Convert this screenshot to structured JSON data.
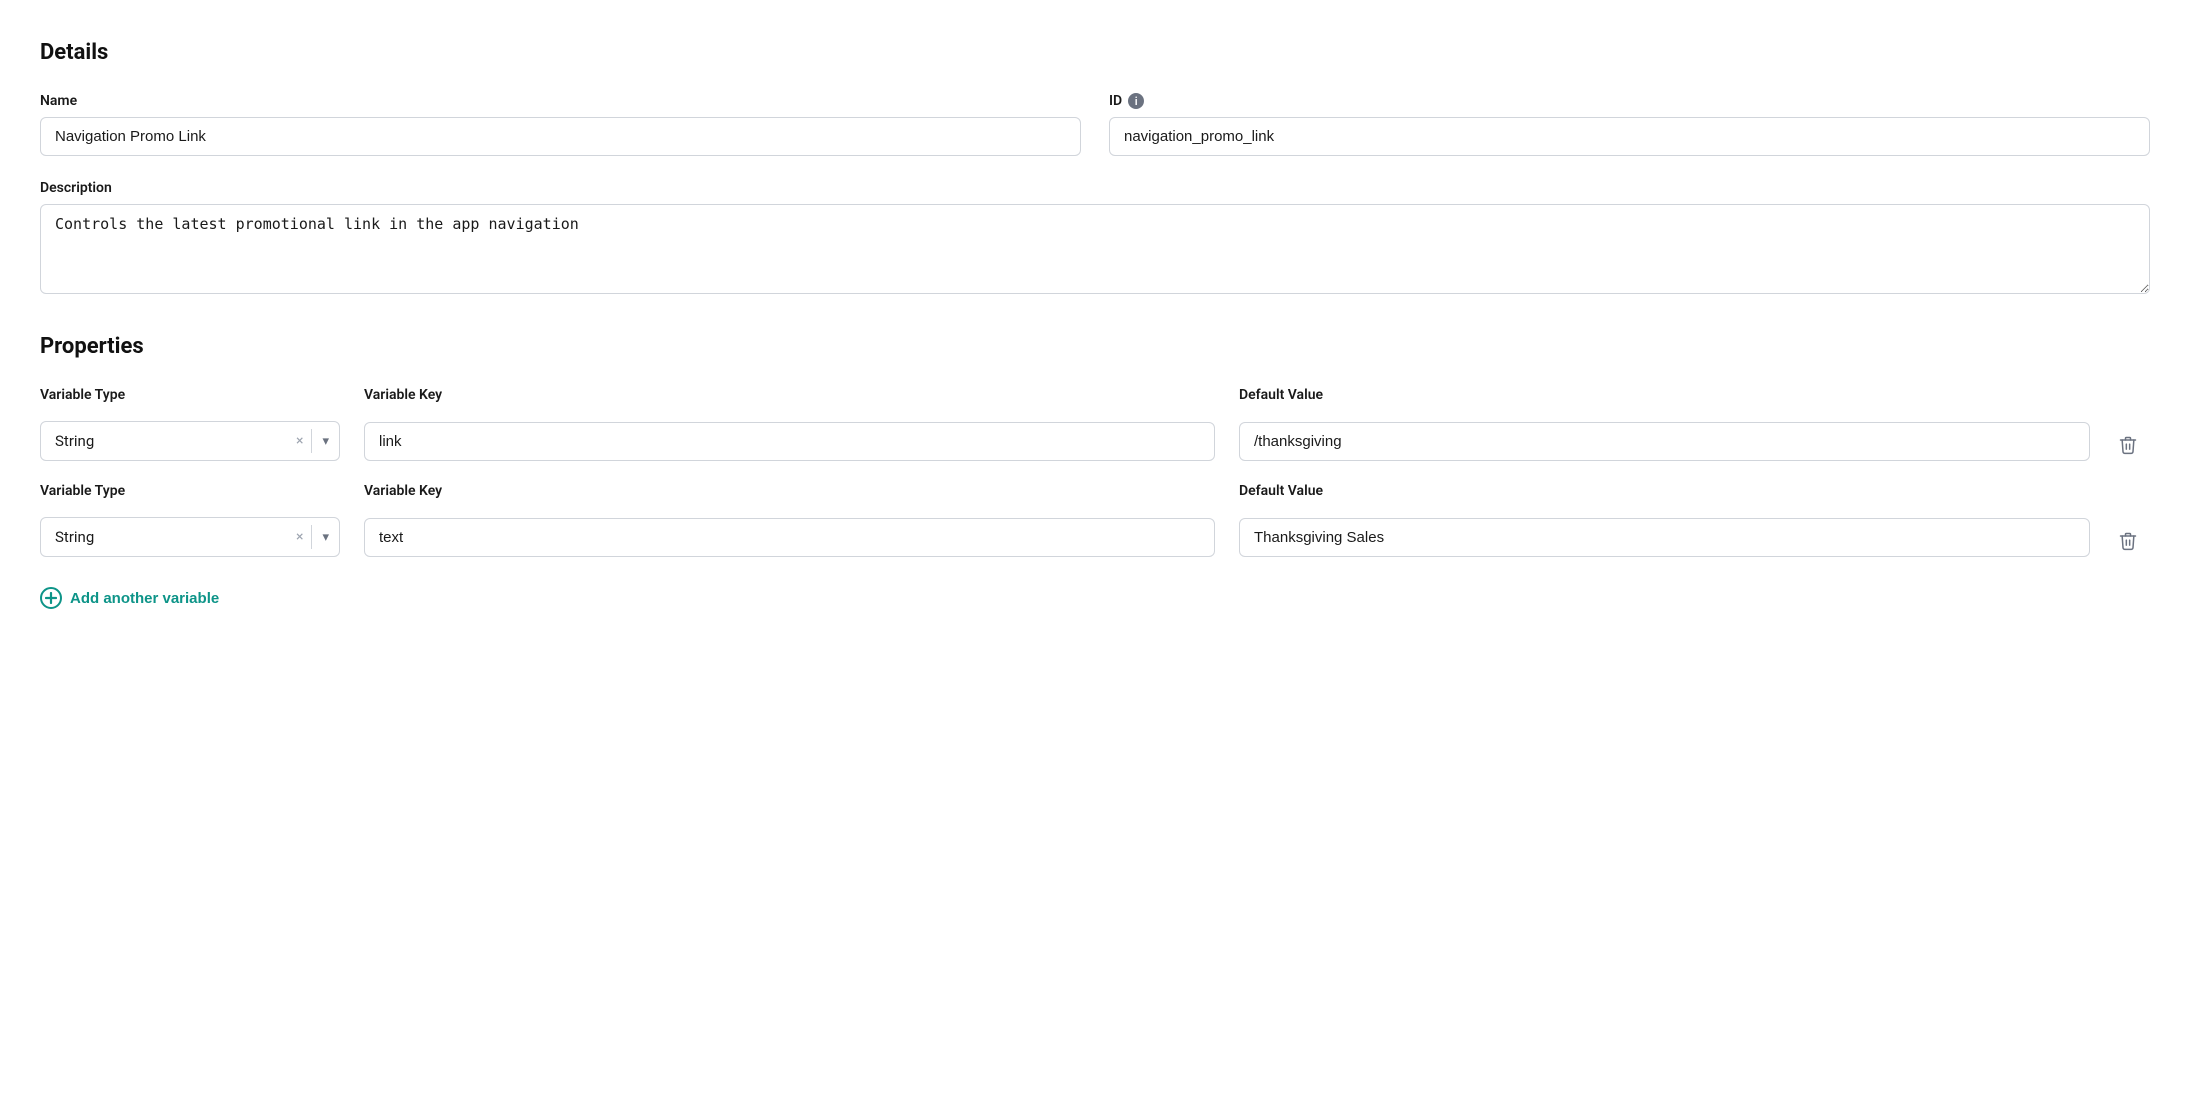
{
  "details": {
    "title": "Details",
    "name_label": "Name",
    "name_value": "Navigation Promo Link",
    "id_label": "ID",
    "id_value": "navigation_promo_link",
    "description_label": "Description",
    "description_value": "Controls the latest promotional link in the app navigation"
  },
  "properties": {
    "title": "Properties",
    "variable_type_label": "Variable Type",
    "variable_key_label": "Variable Key",
    "default_value_label": "Default Value",
    "variables": [
      {
        "type": "String",
        "key": "link",
        "default_value": "/thanksgiving"
      },
      {
        "type": "String",
        "key": "text",
        "default_value": "Thanksgiving Sales"
      }
    ],
    "add_label": "Add another variable"
  },
  "icons": {
    "info": "i",
    "clear": "×",
    "chevron_down": "▾",
    "trash": "🗑",
    "plus": "+"
  }
}
